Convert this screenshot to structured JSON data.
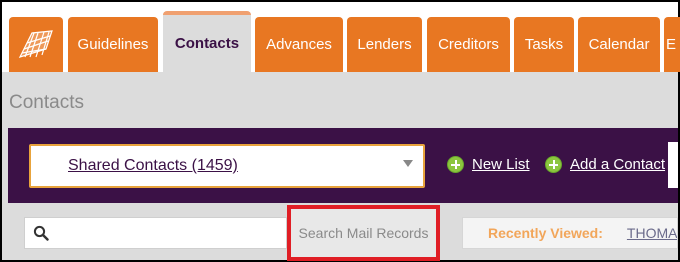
{
  "nav": {
    "tabs": [
      {
        "label": "Guidelines"
      },
      {
        "label": "Contacts"
      },
      {
        "label": "Advances"
      },
      {
        "label": "Lenders"
      },
      {
        "label": "Creditors"
      },
      {
        "label": "Tasks"
      },
      {
        "label": "Calendar"
      },
      {
        "label": "E"
      }
    ],
    "active_tab": "Contacts"
  },
  "page": {
    "title": "Contacts"
  },
  "contacts_bar": {
    "list_select_value": "Shared Contacts (1459)",
    "new_list_label": "New List",
    "add_contact_label": "Add a Contact"
  },
  "search": {
    "placeholder": "",
    "mail_records_label": "Search Mail Records"
  },
  "recently_viewed": {
    "label": "Recently Viewed:",
    "items": [
      "THOMAS"
    ]
  },
  "colors": {
    "tab_orange": "#e87722",
    "band_purple": "#3b1146",
    "highlight_red": "#e01e25",
    "plus_green": "#8cc63f",
    "recent_orange": "#f2a65a"
  }
}
